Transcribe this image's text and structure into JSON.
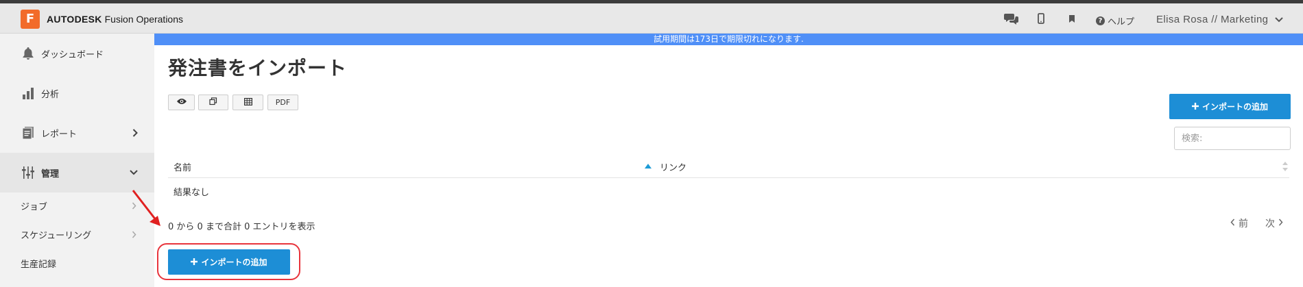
{
  "header": {
    "logo_letter": "F",
    "brand": "AUTODESK",
    "product": "Fusion Operations",
    "help_label": "ヘルプ",
    "user_label": "Elisa Rosa // Marketing",
    "icons": [
      "chat-icon",
      "mobile-icon",
      "bookmark-icon",
      "help-icon",
      "chevron-down-icon"
    ]
  },
  "banner": {
    "text": "試用期間は173日で期限切れになります."
  },
  "sidebar": {
    "items": [
      {
        "label": "ダッシュボード",
        "icon": "bell-icon"
      },
      {
        "label": "分析",
        "icon": "bar-chart-icon"
      },
      {
        "label": "レポート",
        "icon": "report-icon"
      },
      {
        "label": "管理",
        "icon": "sliders-icon"
      }
    ],
    "sub_items": [
      {
        "label": "ジョブ"
      },
      {
        "label": "スケジューリング"
      },
      {
        "label": "生産記録"
      }
    ]
  },
  "main": {
    "title": "発注書をインポート",
    "toolbar": [
      {
        "icon": "eye-icon"
      },
      {
        "icon": "copy-icon"
      },
      {
        "icon": "table-icon"
      },
      {
        "label": "PDF"
      }
    ],
    "add_import_label": "インポートの追加",
    "search_placeholder": "検索:",
    "table": {
      "columns": [
        "名前",
        "リンク"
      ],
      "empty_text": "結果なし"
    },
    "info": {
      "prefix": "0",
      "mid1": " から ",
      "to": "0",
      "mid2": " まで合計 ",
      "total": "0",
      "suffix": " エントリを表示"
    },
    "pager": {
      "prev": "前",
      "next": "次"
    }
  },
  "colors": {
    "accent": "#1d8ed6",
    "banner": "#4f8ff7",
    "logo": "#f26b2a",
    "highlight": "#e8343c"
  }
}
